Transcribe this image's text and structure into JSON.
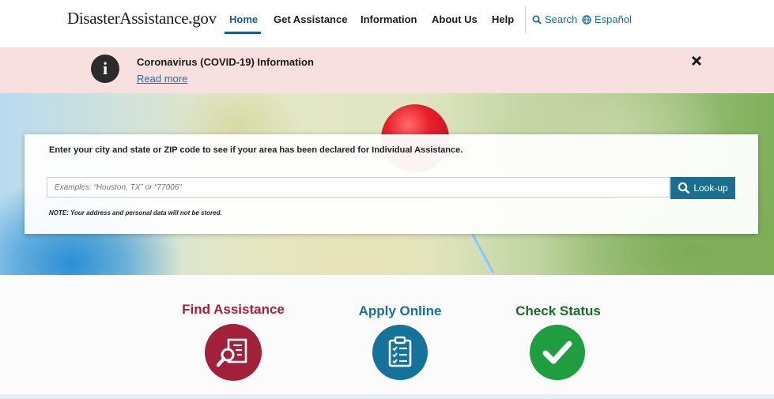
{
  "header": {
    "logo": {
      "word1": "Disaster",
      "word2": "Assistance",
      "dot": ".",
      "tld": "gov"
    },
    "nav": [
      {
        "label": "Home",
        "active": true
      },
      {
        "label": "Get Assistance"
      },
      {
        "label": "Information"
      },
      {
        "label": "About Us"
      },
      {
        "label": "Help"
      }
    ],
    "search_label": "Search",
    "language_label": "Español"
  },
  "alert": {
    "icon": "info-icon",
    "title": "Coronavirus (COVID-19) Information",
    "link": "Read more",
    "close_icon": "close-icon"
  },
  "lookup": {
    "prompt": "Enter your city and state or ZIP code to see if your area has been declared for Individual Assistance.",
    "placeholder": "Examples: “Houston, TX” or “77006”",
    "button": "Look-up",
    "note": "NOTE: Your address and personal data will not be stored."
  },
  "actions": [
    {
      "title": "Find Assistance",
      "color": "#a3203b",
      "icon": "document-search-icon"
    },
    {
      "title": "Apply Online",
      "color": "#13739a",
      "icon": "clipboard-checklist-icon"
    },
    {
      "title": "Check Status",
      "color": "#1e9e3e",
      "icon": "checkmark-icon"
    }
  ],
  "colors": {
    "primary": "#1a5d86",
    "link": "#1a6fa3",
    "alert_bg": "#f8dfe0"
  }
}
